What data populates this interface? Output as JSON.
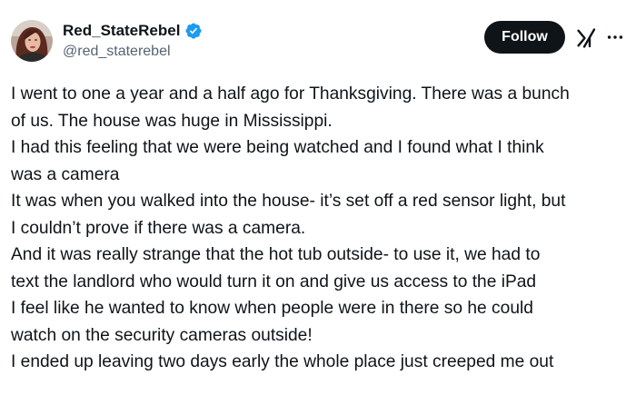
{
  "author": {
    "display_name": "Red_StateRebel",
    "handle": "@red_staterebel",
    "verified": true,
    "verified_color": "#1d9bf0",
    "avatar": "profile-photo"
  },
  "actions": {
    "follow_label": "Follow",
    "follow_bg": "#0f1419",
    "grok_icon": "grok-icon",
    "more_icon": "more-options-icon"
  },
  "post": {
    "lines": [
      "I went to one a year and a half ago for Thanksgiving. There was a bunch",
      "of us. The house was huge in Mississippi.",
      "I had this feeling that we were being watched and I found what I think",
      "was a camera",
      "It was when you walked into the house- it’s set off a red sensor light, but",
      "I couldn’t prove if there was a camera.",
      "And it was really strange that the hot tub outside- to use it, we had to",
      "text the landlord who would turn it on and give us access to the iPad",
      "I feel like he wanted to know when people were in there so he could",
      "watch on the security cameras outside!",
      "I ended up leaving two days early the whole place just creeped me out"
    ]
  }
}
